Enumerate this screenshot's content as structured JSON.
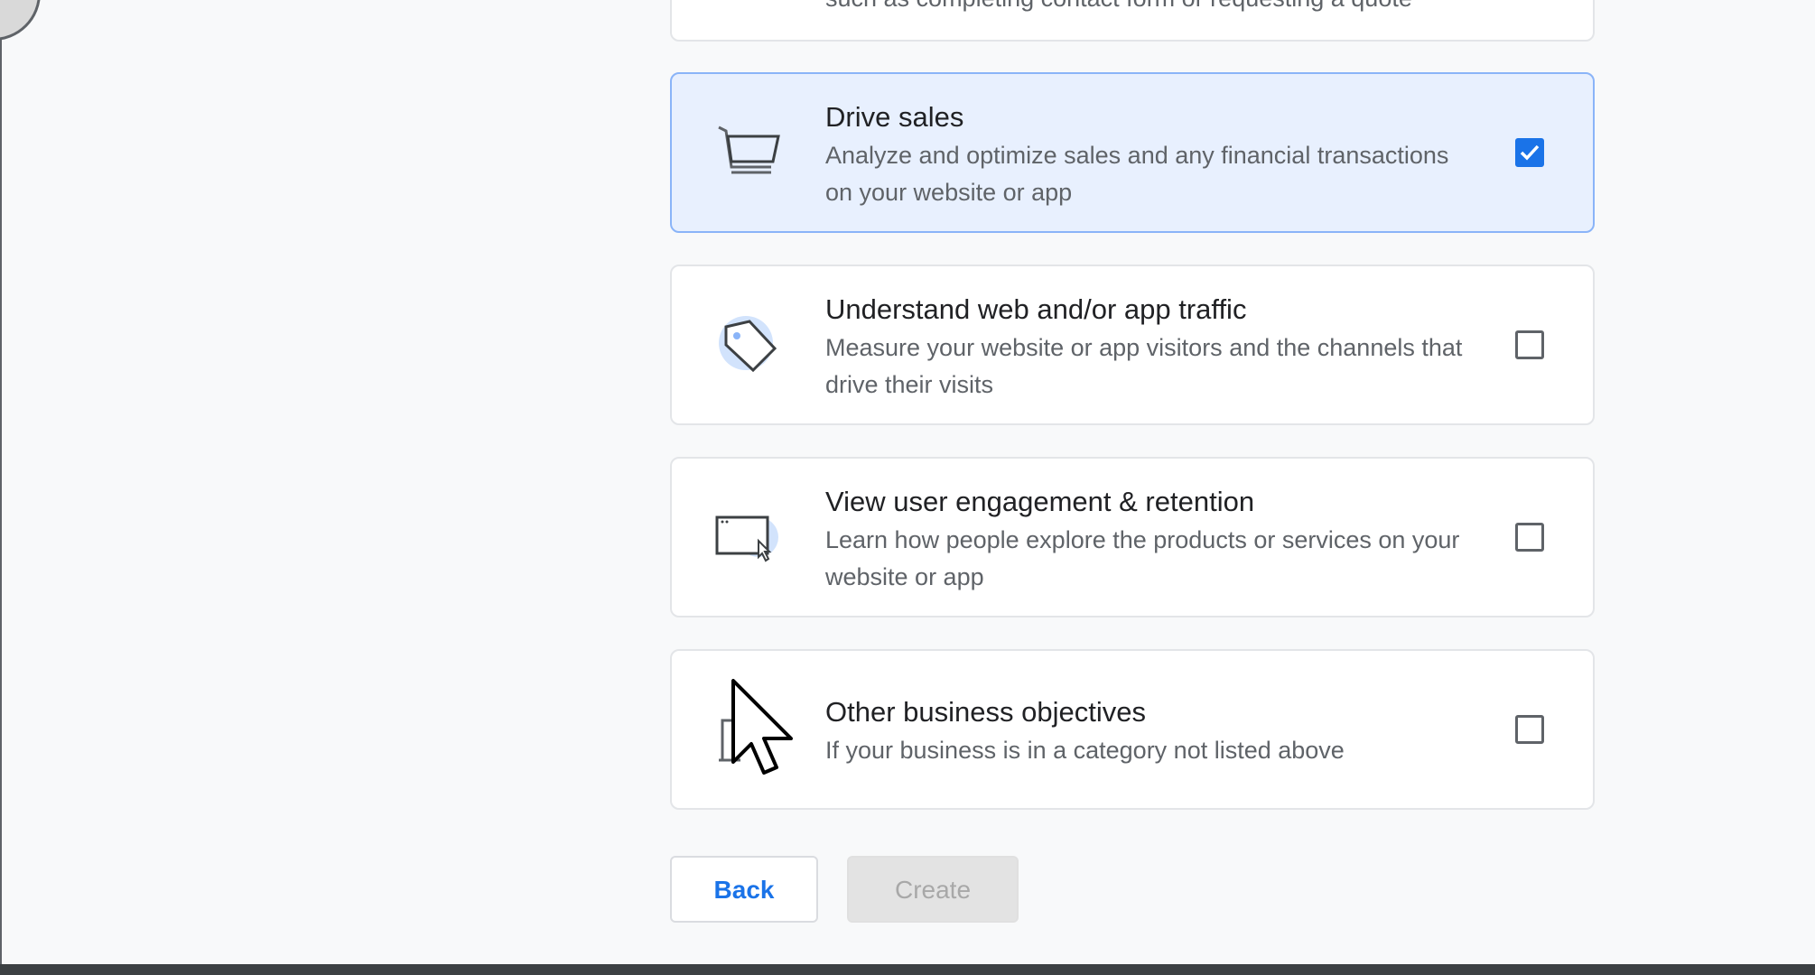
{
  "partial_card": {
    "desc": "such as completing contact form or requesting a quote"
  },
  "objectives": [
    {
      "title": "Drive sales",
      "desc": "Analyze and optimize sales and any financial transactions on your website or app",
      "icon": "shopping-cart-icon",
      "checked": true
    },
    {
      "title": "Understand web and/or app traffic",
      "desc": "Measure your website or app visitors and the channels that drive their visits",
      "icon": "tag-icon",
      "checked": false
    },
    {
      "title": "View user engagement & retention",
      "desc": "Learn how people explore the products or services on your website or app",
      "icon": "browser-window-icon",
      "checked": false
    },
    {
      "title": "Other business objectives",
      "desc": "If your business is in a category not listed above",
      "icon": "briefcase-icon",
      "checked": false
    }
  ],
  "actions": {
    "back_label": "Back",
    "create_label": "Create"
  },
  "colors": {
    "accent": "#1a73e8",
    "selected_bg": "#e8f0fe",
    "selected_border": "#8ab4f8"
  }
}
